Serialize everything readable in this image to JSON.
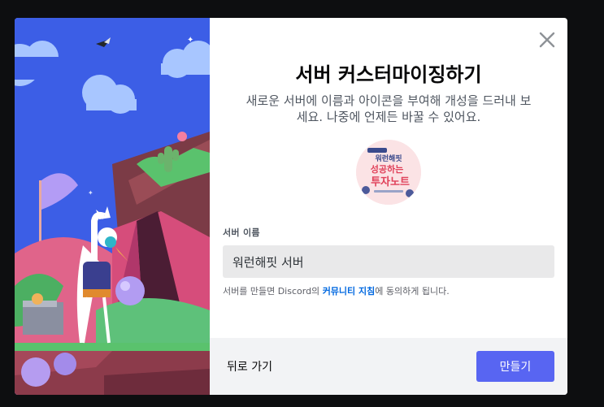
{
  "modal": {
    "title": "서버 커스터마이징하기",
    "subtitle": "새로운 서버에 이름과 아이콘을 부여해 개성을 드러내 보세요. 나중에 언제든 바꿀 수 있어요.",
    "server_icon": {
      "logo_text_top": "워런해핏",
      "logo_text_mid": "성공하는",
      "logo_text_bottom": "투자노트"
    },
    "name_field": {
      "label": "서버 이름",
      "value": "워런해핏 서버"
    },
    "terms": {
      "prefix": "서버를 만들면 Discord의 ",
      "link": "커뮤니티 지침",
      "suffix": "에 동의하게 됩니다."
    },
    "footer": {
      "back_label": "뒤로 가기",
      "create_label": "만들기"
    }
  },
  "colors": {
    "primary_button": "#5865f2",
    "link": "#0068e0",
    "art_sky": "#3c5ee6"
  }
}
